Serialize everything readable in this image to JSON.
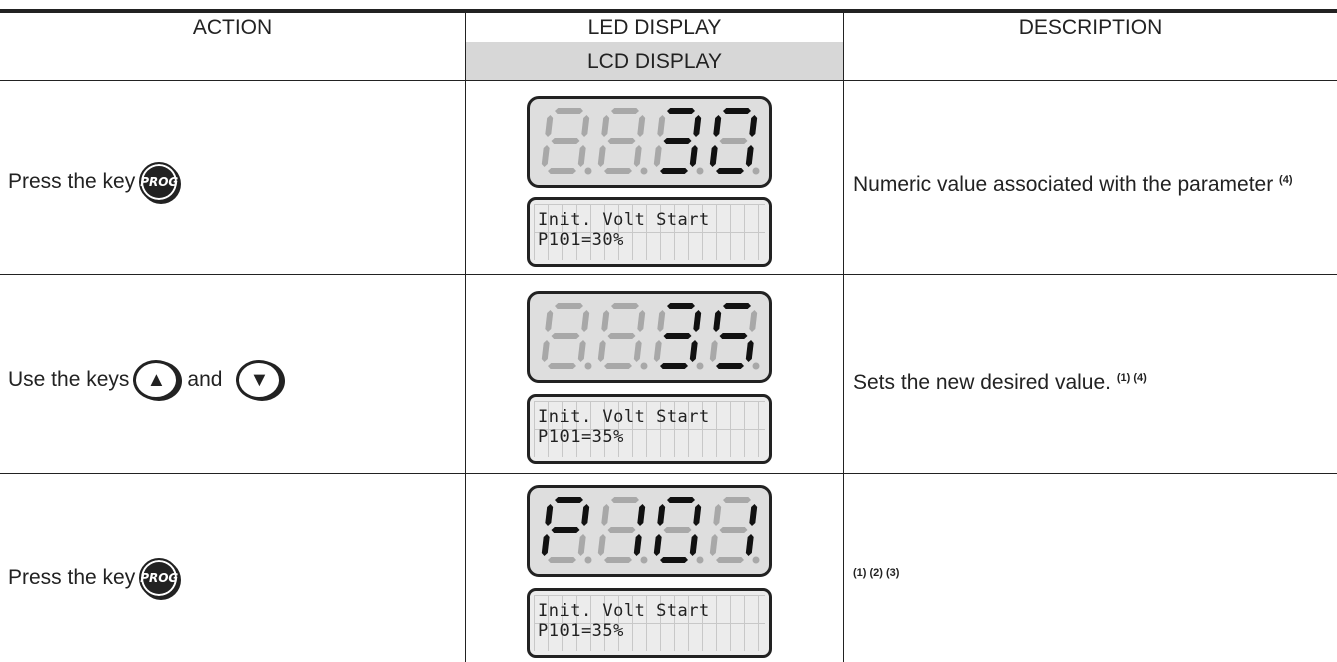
{
  "table": {
    "headers": {
      "action": "ACTION",
      "led": "LED DISPLAY",
      "lcd": "LCD DISPLAY",
      "description": "DESCRIPTION"
    },
    "rows": [
      {
        "action_text": "Press the key",
        "key1": "PROG",
        "led_digits": [
          "8",
          "8",
          "3",
          "0"
        ],
        "led_active": [
          false,
          false,
          true,
          true
        ],
        "lcd_line1": "Init. Volt Start",
        "lcd_line2": "P101=30%",
        "description": "Numeric value associated with the parameter",
        "description_notes": "(4)"
      },
      {
        "action_text": "Use the keys",
        "action_joiner": "and",
        "key1_icon": "up-arrow-icon",
        "key2_icon": "down-arrow-icon",
        "led_digits": [
          "8",
          "8",
          "3",
          "5"
        ],
        "led_active": [
          false,
          false,
          true,
          true
        ],
        "lcd_line1": "Init. Volt Start",
        "lcd_line2": "P101=35%",
        "description": "Sets the new desired value.",
        "description_notes": "(1) (4)"
      },
      {
        "action_text": "Press the key",
        "key1": "PROG",
        "led_digits": [
          "P",
          "1",
          "0",
          "1"
        ],
        "led_active": [
          true,
          true,
          true,
          true
        ],
        "lcd_line1": "Init. Volt Start",
        "lcd_line2": "P101=35%",
        "description": "",
        "description_notes": "(1) (2) (3)"
      }
    ]
  },
  "colors": {
    "segment_on": "#111111",
    "segment_off": "#a8a8a8",
    "header_shade": "#d7d7d7"
  }
}
